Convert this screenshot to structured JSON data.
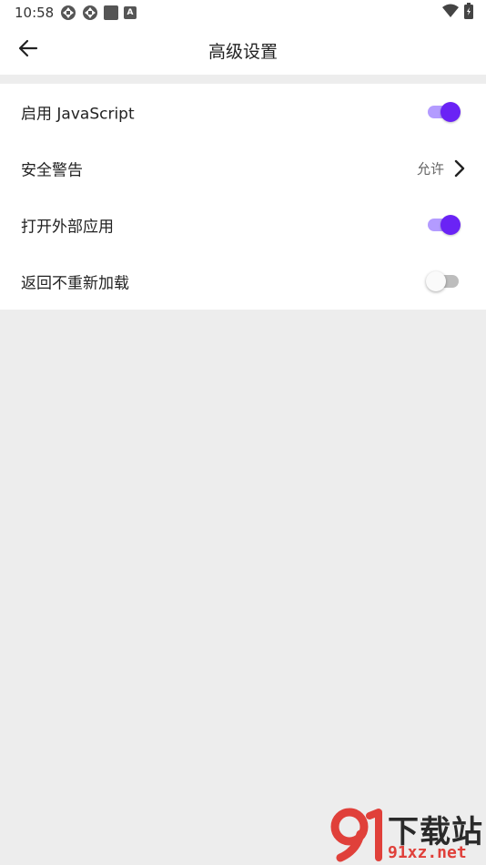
{
  "status_bar": {
    "time": "10:58",
    "left_icons": [
      "sync-icon",
      "sync-icon",
      "square-icon",
      "keyboard-a-icon"
    ],
    "right_icons": [
      "wifi-icon",
      "battery-icon"
    ],
    "keyboard_letter": "A"
  },
  "app_bar": {
    "back_icon": "arrow-left-icon",
    "title": "高级设置"
  },
  "settings": [
    {
      "label": "启用 JavaScript",
      "control": "toggle",
      "enabled": true
    },
    {
      "label": "安全警告",
      "control": "value",
      "value": "允许",
      "icon": "chevron-right-icon"
    },
    {
      "label": "打开外部应用",
      "control": "toggle",
      "enabled": true
    },
    {
      "label": "返回不重新加载",
      "control": "toggle",
      "enabled": false
    }
  ],
  "colors": {
    "accent": "#6a23f5",
    "accent_track": "#b39bff",
    "background": "#ededed",
    "surface": "#ffffff",
    "watermark_red": "#e0403a"
  },
  "watermark": {
    "logo": "91-logo",
    "text_top": "下载站",
    "text_bottom": "91xz.net"
  }
}
